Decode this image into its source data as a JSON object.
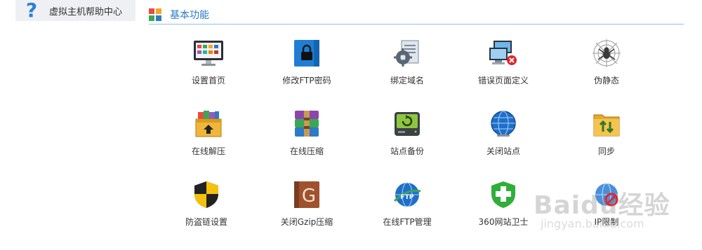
{
  "sidebar": {
    "help_label": "虚拟主机帮助中心",
    "help_icon": "question-mark-icon"
  },
  "section": {
    "title": "基本功能",
    "icon": "colored-grid-icon"
  },
  "functions": [
    {
      "label": "设置首页",
      "icon": "monitor-apps-icon"
    },
    {
      "label": "修改FTP密码",
      "icon": "blue-lock-folder-icon"
    },
    {
      "label": "绑定域名",
      "icon": "settings-document-icon"
    },
    {
      "label": "错误页面定义",
      "icon": "network-error-icon"
    },
    {
      "label": "伪静态",
      "icon": "spider-web-icon"
    },
    {
      "label": "在线解压",
      "icon": "open-archive-icon"
    },
    {
      "label": "在线压缩",
      "icon": "winrar-icon"
    },
    {
      "label": "站点备份",
      "icon": "backup-drive-icon"
    },
    {
      "label": "关闭站点",
      "icon": "globe-icon"
    },
    {
      "label": "同步",
      "icon": "sync-folder-icon"
    },
    {
      "label": "防盗链设置",
      "icon": "shield-icon"
    },
    {
      "label": "关闭Gzip压缩",
      "icon": "gzip-icon"
    },
    {
      "label": "在线FTP管理",
      "icon": "ftp-globe-icon"
    },
    {
      "label": "360网站卫士",
      "icon": "green-cross-shield-icon"
    },
    {
      "label": "IP限制",
      "icon": "ip-restrict-icon"
    }
  ],
  "watermark": {
    "text": "Baidu经验",
    "sub": "jingyan.baidu.com"
  },
  "colors": {
    "accent": "#2d7ac6",
    "divider": "#8fbfe8",
    "sidebar_bg": "#eef0f3"
  }
}
